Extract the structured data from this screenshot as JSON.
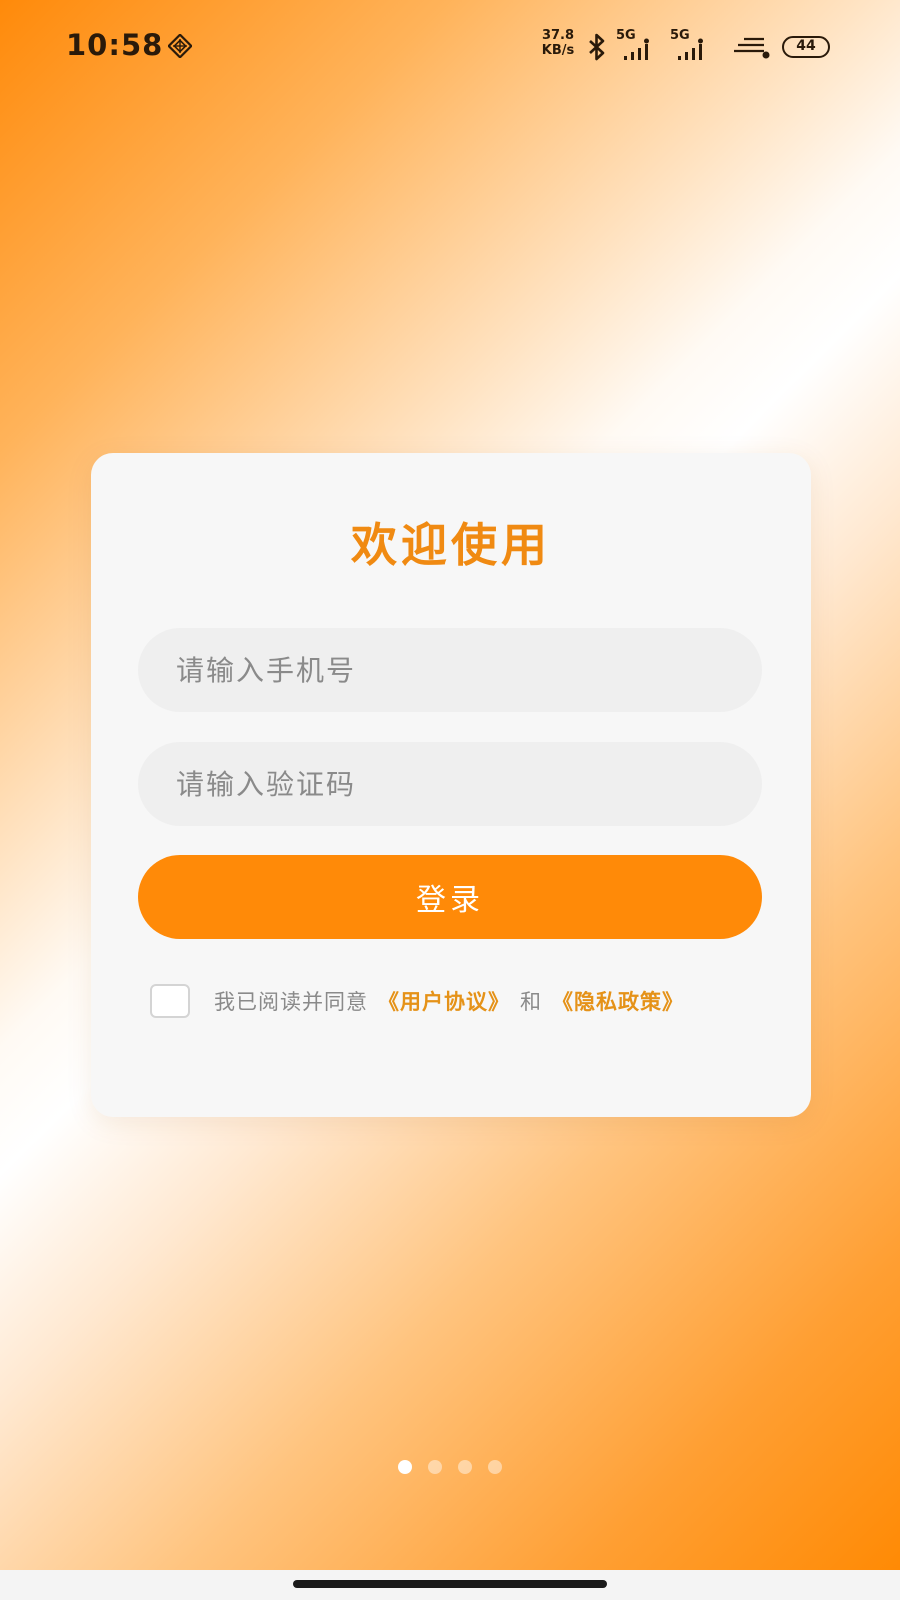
{
  "status_bar": {
    "time": "10:58",
    "net_speed_value": "37.8",
    "net_speed_unit": "KB/s",
    "signal_1_label": "5G",
    "signal_2_label": "5G",
    "battery": "44"
  },
  "login": {
    "title": "欢迎使用",
    "phone_placeholder": "请输入手机号",
    "code_placeholder": "请输入验证码",
    "login_button": "登录",
    "agree_prefix": "我已阅读并同意",
    "user_agreement": "《用户协议》",
    "and": "和",
    "privacy_policy": "《隐私政策》",
    "agreed": false
  },
  "pager": {
    "total": 4,
    "active_index": 0
  },
  "colors": {
    "accent": "#ff8a08",
    "title": "#f08a12",
    "link": "#e59218"
  }
}
